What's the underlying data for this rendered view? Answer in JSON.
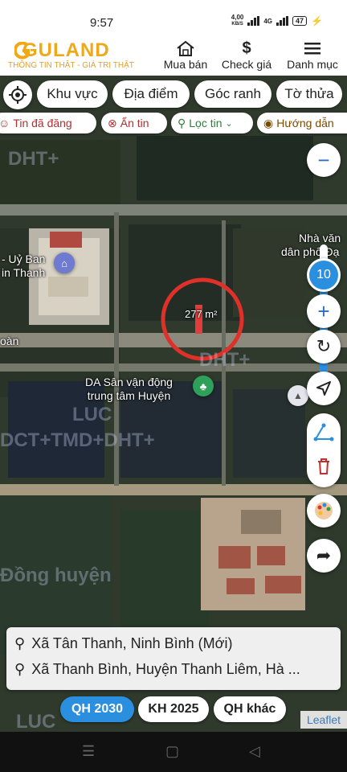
{
  "status": {
    "time": "9:57",
    "speed_value": "4,00",
    "speed_unit": "KB/S",
    "network": "4G",
    "battery": "47"
  },
  "header": {
    "brand": "GULAND",
    "tagline": "THÔNG TIN THẬT - GIÁ TRỊ THẬT",
    "nav": [
      {
        "label": "Mua bán",
        "icon": "house-icon"
      },
      {
        "label": "Check giá",
        "icon": "dollar-icon"
      },
      {
        "label": "Danh mục",
        "icon": "menu-icon"
      }
    ]
  },
  "filters": {
    "chips": [
      "Khu vực",
      "Địa điểm",
      "Góc ranh",
      "Tờ thửa"
    ],
    "chips2": [
      "Tin đã đăng",
      "Ẩn tin",
      "Lọc tin",
      "Hướng dẫn"
    ]
  },
  "map": {
    "zoom_level": "10",
    "parcel_area": "277 m²",
    "labels": {
      "uy_ban_1": "- Uỷ Ban",
      "uy_ban_2": "in Thanh",
      "nha_van_hoa_1": "Nhà văn",
      "nha_van_hoa_2": "dân phố Đạ",
      "doan": "oàn",
      "da_svd_1": "DA Sân vận động",
      "da_svd_2": "trung tâm Huyện"
    },
    "watermarks": [
      "DHT+",
      "DHT+",
      "LUC",
      "DCT+TMD+DHT+",
      "LUC",
      "Đồng huyện"
    ]
  },
  "address": {
    "new": "Xã Tân Thanh, Ninh Bình (Mới)",
    "old": "Xã Thanh Bình, Huyện Thanh Liêm, Hà ..."
  },
  "plans": [
    "QH 2030",
    "KH 2025",
    "QH khác"
  ],
  "attribution": "Leaflet",
  "colors": {
    "accent": "#2b8fe0",
    "brand": "#f0a818",
    "parcel_circle": "#e0302a"
  }
}
